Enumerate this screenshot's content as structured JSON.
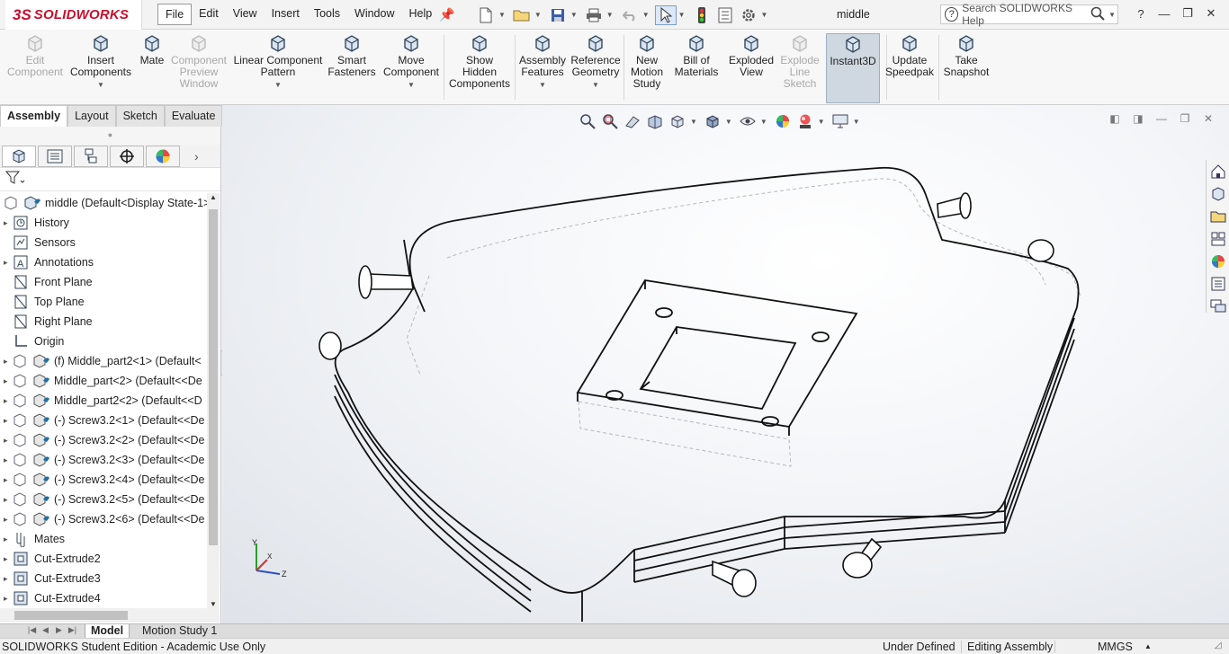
{
  "app": {
    "brand_prefix": "3S",
    "brand_name": "SOLIDWORKS",
    "document_title": "middle"
  },
  "menu": [
    "File",
    "Edit",
    "View",
    "Insert",
    "Tools",
    "Window",
    "Help"
  ],
  "help_search": {
    "placeholder": "Search SOLIDWORKS Help"
  },
  "window_controls": {
    "help": "?",
    "minimize": "—",
    "restore": "❐",
    "close": "✕"
  },
  "ribbon": [
    {
      "id": "edit-component",
      "label": [
        "Edit",
        "Component"
      ],
      "disabled": true
    },
    {
      "id": "insert-components",
      "label": [
        "Insert",
        "Components"
      ],
      "dropdown": true
    },
    {
      "id": "mate",
      "label": [
        "Mate"
      ]
    },
    {
      "id": "component-preview-window",
      "label": [
        "Component",
        "Preview",
        "Window"
      ],
      "disabled": true
    },
    {
      "id": "linear-component-pattern",
      "label": [
        "Linear Component",
        "Pattern"
      ],
      "dropdown": true
    },
    {
      "id": "smart-fasteners",
      "label": [
        "Smart",
        "Fasteners"
      ]
    },
    {
      "id": "move-component",
      "label": [
        "Move",
        "Component"
      ],
      "dropdown": true
    },
    {
      "id": "show-hidden-components",
      "label": [
        "Show",
        "Hidden",
        "Components"
      ]
    },
    {
      "id": "assembly-features",
      "label": [
        "Assembly",
        "Features"
      ],
      "dropdown": true
    },
    {
      "id": "reference-geometry",
      "label": [
        "Reference",
        "Geometry"
      ],
      "dropdown": true
    },
    {
      "id": "new-motion-study",
      "label": [
        "New",
        "Motion",
        "Study"
      ]
    },
    {
      "id": "bill-of-materials",
      "label": [
        "Bill of",
        "Materials"
      ]
    },
    {
      "id": "exploded-view",
      "label": [
        "Exploded",
        "View"
      ]
    },
    {
      "id": "explode-line-sketch",
      "label": [
        "Explode",
        "Line",
        "Sketch"
      ],
      "disabled": true
    },
    {
      "id": "instant3d",
      "label": [
        "Instant3D"
      ],
      "pressed": true
    },
    {
      "id": "update-speedpak",
      "label": [
        "Update",
        "Speedpak"
      ]
    },
    {
      "id": "take-snapshot",
      "label": [
        "Take",
        "Snapshot"
      ]
    }
  ],
  "cm_tabs": [
    "Assembly",
    "Layout",
    "Sketch",
    "Evaluate"
  ],
  "tree": [
    {
      "label": "middle  (Default<Display State-1>",
      "icon": "assembly-icon",
      "expander": ""
    },
    {
      "label": "History",
      "icon": "history-icon",
      "expander": "▸"
    },
    {
      "label": "Sensors",
      "icon": "sensors-icon",
      "expander": ""
    },
    {
      "label": "Annotations",
      "icon": "annotations-icon",
      "expander": "▸"
    },
    {
      "label": "Front Plane",
      "icon": "plane-icon",
      "expander": ""
    },
    {
      "label": "Top Plane",
      "icon": "plane-icon",
      "expander": ""
    },
    {
      "label": "Right Plane",
      "icon": "plane-icon",
      "expander": ""
    },
    {
      "label": "Origin",
      "icon": "origin-icon",
      "expander": ""
    },
    {
      "label": "(f) Middle_part2<1> (Default<",
      "icon": "part-icon",
      "expander": "▸"
    },
    {
      "label": "Middle_part<2> (Default<<De",
      "icon": "part-icon",
      "expander": "▸"
    },
    {
      "label": "Middle_part2<2> (Default<<D",
      "icon": "part-icon",
      "expander": "▸"
    },
    {
      "label": "(-) Screw3.2<1> (Default<<De",
      "icon": "part-icon",
      "expander": "▸"
    },
    {
      "label": "(-) Screw3.2<2> (Default<<De",
      "icon": "part-icon",
      "expander": "▸"
    },
    {
      "label": "(-) Screw3.2<3> (Default<<De",
      "icon": "part-icon",
      "expander": "▸"
    },
    {
      "label": "(-) Screw3.2<4> (Default<<De",
      "icon": "part-icon",
      "expander": "▸"
    },
    {
      "label": "(-) Screw3.2<5> (Default<<De",
      "icon": "part-icon",
      "expander": "▸"
    },
    {
      "label": "(-) Screw3.2<6> (Default<<De",
      "icon": "part-icon",
      "expander": "▸"
    },
    {
      "label": "Mates",
      "icon": "mates-icon",
      "expander": "▸"
    },
    {
      "label": "Cut-Extrude2",
      "icon": "feature-icon",
      "expander": "▸"
    },
    {
      "label": "Cut-Extrude3",
      "icon": "feature-icon",
      "expander": "▸"
    },
    {
      "label": "Cut-Extrude4",
      "icon": "feature-icon",
      "expander": "▸"
    }
  ],
  "triad": {
    "x": "X",
    "y": "Y",
    "z": "Z"
  },
  "bottom_tabs": [
    "Model",
    "Motion Study 1"
  ],
  "status": {
    "edition": "SOLIDWORKS Student Edition - Academic Use Only",
    "definition": "Under Defined",
    "mode": "Editing Assembly",
    "units": "MMGS",
    "units_caret": "▲"
  },
  "colors": {
    "brand": "#c8102e",
    "accent": "#2a6ec9",
    "selected_bg": "#cfd7e0"
  }
}
